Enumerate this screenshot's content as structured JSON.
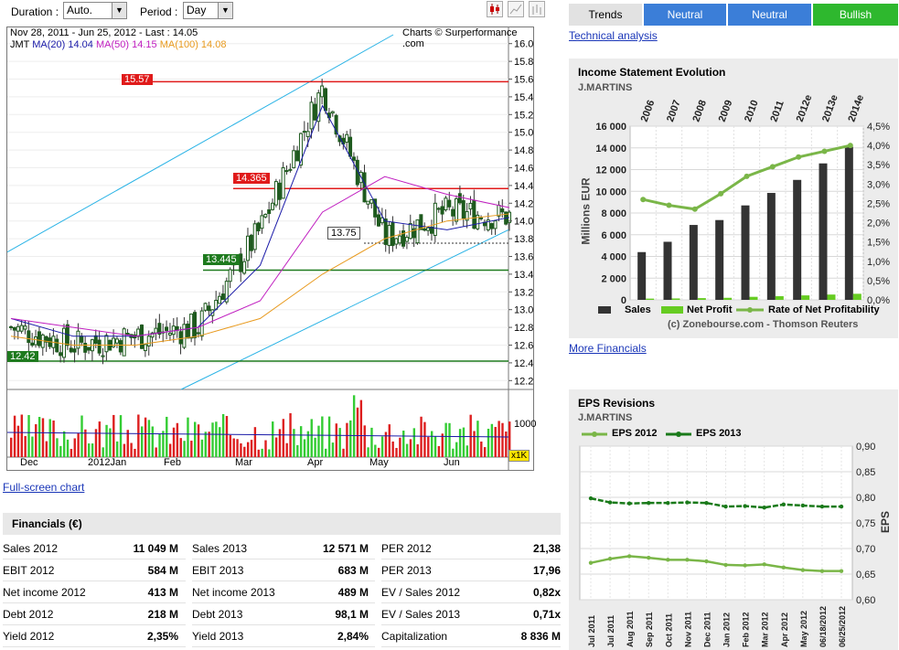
{
  "controls": {
    "duration_label": "Duration :",
    "duration_value": "Auto.",
    "period_label": "Period :",
    "period_value": "Day"
  },
  "chart": {
    "header_left": "Nov 28, 2011 - Jun 25, 2012 - Last : 14.05",
    "header_right": "Charts © Surperformance .com",
    "legend_ticker": "JMT",
    "legend_ma20": "MA(20) 14.04",
    "legend_ma50": "MA(50) 14.15",
    "legend_ma100": "MA(100) 14.08",
    "price_labels": [
      "16.00",
      "15.80",
      "15.60",
      "15.40",
      "15.20",
      "15.00",
      "14.80",
      "14.60",
      "14.40",
      "14.20",
      "14.00",
      "13.80",
      "13.60",
      "13.40",
      "13.20",
      "13.00",
      "12.80",
      "12.60",
      "12.40",
      "12.20"
    ],
    "level_1557": "15.57",
    "level_14365": "14.365",
    "level_1375": "13.75",
    "level_13445": "13.445",
    "level_1242": "12.42",
    "volume_label": "1000",
    "volume_unit": "x1K",
    "months": [
      "Dec",
      "2012Jan",
      "Feb",
      "Mar",
      "Apr",
      "May",
      "Jun"
    ],
    "fullscreen_link": "Full-screen chart"
  },
  "trends": {
    "label": "Trends",
    "cells": [
      "Neutral",
      "Neutral",
      "Bullish"
    ],
    "colors": [
      "#3b7ed8",
      "#3b7ed8",
      "#2eb82e"
    ],
    "link": "Technical analysis"
  },
  "income": {
    "title": "Income Statement Evolution",
    "company": "J.MARTINS",
    "years": [
      "2006",
      "2007",
      "2008",
      "2009",
      "2010",
      "2011",
      "2012e",
      "2013e",
      "2014e"
    ],
    "y_left": [
      "16 000",
      "14 000",
      "12 000",
      "10 000",
      "8 000",
      "6 000",
      "4 000",
      "2 000",
      "0"
    ],
    "y_right": [
      "4,5%",
      "4,0%",
      "3,5%",
      "3,0%",
      "2,5%",
      "2,0%",
      "1,5%",
      "1,0%",
      "0,5%",
      "0,0%"
    ],
    "y_axis_title": "Millions EUR",
    "legend_sales": "Sales",
    "legend_profit": "Net Profit",
    "legend_rate": "Rate of Net Profitability",
    "credit": "(c) Zonebourse.com - Thomson Reuters",
    "link": "More Financials"
  },
  "eps": {
    "title": "EPS Revisions",
    "company": "J.MARTINS",
    "legend_2012": "EPS 2012",
    "legend_2013": "EPS 2013",
    "y_right": [
      "0,90",
      "0,85",
      "0,80",
      "0,75",
      "0,70",
      "0,65",
      "0,60"
    ],
    "y_axis_title": "EPS",
    "x_labels": [
      "Jul 2011",
      "Jul 2011",
      "Aug 2011",
      "Sep 2011",
      "Oct 2011",
      "Nov 2011",
      "Dec 2011",
      "Jan 2012",
      "Feb 2012",
      "Mar 2012",
      "Apr 2012",
      "May 2012",
      "06/18/2012",
      "06/25/2012"
    ]
  },
  "financials": {
    "title": "Financials (€)",
    "rows": [
      [
        [
          "Sales 2012",
          "11 049 M"
        ],
        [
          "Sales 2013",
          "12 571 M"
        ],
        [
          "PER 2012",
          "21,38"
        ]
      ],
      [
        [
          "EBIT 2012",
          "584 M"
        ],
        [
          "EBIT 2013",
          "683 M"
        ],
        [
          "PER 2013",
          "17,96"
        ]
      ],
      [
        [
          "Net income 2012",
          "413 M"
        ],
        [
          "Net income 2013",
          "489 M"
        ],
        [
          "EV / Sales 2012",
          "0,82x"
        ]
      ],
      [
        [
          "Debt 2012",
          "218 M"
        ],
        [
          "Debt 2013",
          "98,1 M"
        ],
        [
          "EV / Sales 2013",
          "0,71x"
        ]
      ],
      [
        [
          "Yield 2012",
          "2,35%"
        ],
        [
          "Yield 2013",
          "2,84%"
        ],
        [
          "Capitalization",
          "8 836 M"
        ]
      ]
    ]
  },
  "chart_data": [
    {
      "type": "line",
      "title": "",
      "ylabel": "",
      "ylim": [
        12.1,
        16.1
      ],
      "x": [
        "Nov 28, 2011",
        "Dec",
        "2012Jan",
        "Feb",
        "Mar",
        "Apr",
        "May",
        "Jun",
        "Jun 25, 2012"
      ],
      "series": [
        {
          "name": "JMT",
          "values": [
            12.8,
            12.6,
            12.7,
            12.8,
            13.9,
            15.5,
            13.8,
            14.1,
            14.05
          ]
        },
        {
          "name": "MA(20)",
          "values": [
            12.9,
            12.7,
            12.7,
            12.8,
            13.5,
            15.3,
            14.0,
            13.9,
            14.04
          ]
        },
        {
          "name": "MA(50)",
          "values": [
            12.9,
            12.8,
            12.7,
            12.8,
            13.1,
            14.1,
            14.5,
            14.3,
            14.15
          ]
        },
        {
          "name": "MA(100)",
          "values": [
            12.7,
            12.6,
            12.6,
            12.7,
            12.9,
            13.4,
            13.8,
            14.0,
            14.08
          ]
        }
      ]
    },
    {
      "type": "bar",
      "title": "Income Statement Evolution",
      "categories": [
        "2006",
        "2007",
        "2008",
        "2009",
        "2010",
        "2011",
        "2012e",
        "2013e",
        "2014e"
      ],
      "ylabel": "Millions EUR",
      "ylim": [
        0,
        16000
      ],
      "series": [
        {
          "name": "Sales",
          "values": [
            4400,
            5350,
            6900,
            7350,
            8700,
            9850,
            11050,
            12570,
            14100
          ]
        },
        {
          "name": "Net Profit",
          "values": [
            115,
            130,
            160,
            190,
            280,
            340,
            413,
            489,
            560
          ]
        },
        {
          "name": "Rate of Net Profitability",
          "values": [
            2.6,
            2.45,
            2.35,
            2.75,
            3.2,
            3.45,
            3.7,
            3.85,
            4.0
          ]
        }
      ]
    },
    {
      "type": "line",
      "title": "EPS Revisions",
      "ylabel": "EPS",
      "ylim": [
        0.6,
        0.9
      ],
      "x": [
        "Jul 2011",
        "Jul 2011",
        "Aug 2011",
        "Sep 2011",
        "Oct 2011",
        "Nov 2011",
        "Dec 2011",
        "Jan 2012",
        "Feb 2012",
        "Mar 2012",
        "Apr 2012",
        "May 2012",
        "06/18/2012",
        "06/25/2012"
      ],
      "series": [
        {
          "name": "EPS 2012",
          "values": [
            0.672,
            0.68,
            0.685,
            0.682,
            0.678,
            0.678,
            0.675,
            0.668,
            0.667,
            0.669,
            0.663,
            0.658,
            0.656,
            0.656
          ]
        },
        {
          "name": "EPS 2013",
          "values": [
            0.798,
            0.79,
            0.788,
            0.789,
            0.789,
            0.79,
            0.789,
            0.782,
            0.783,
            0.78,
            0.786,
            0.784,
            0.782,
            0.782
          ]
        }
      ]
    }
  ]
}
